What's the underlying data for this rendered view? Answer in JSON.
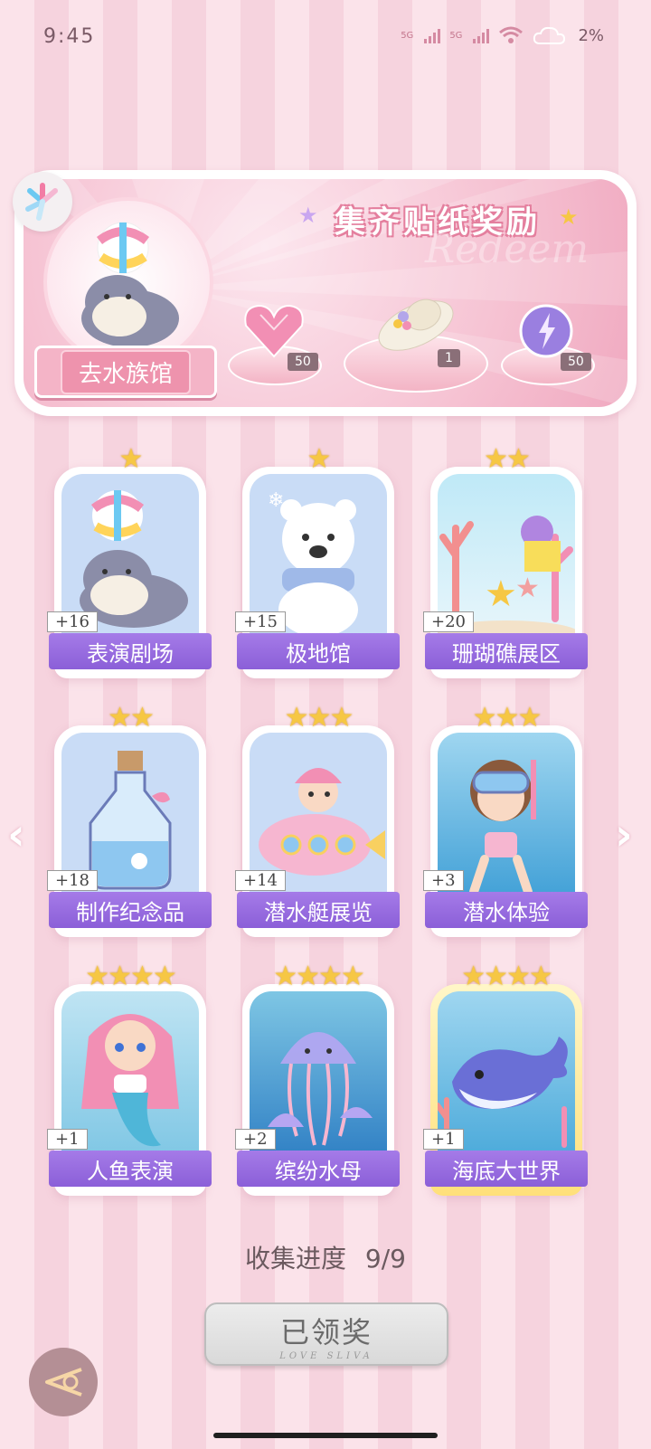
{
  "status": {
    "time": "9:45",
    "net1": "5G",
    "net2": "5G",
    "battery": "2%"
  },
  "banner": {
    "title": "集齐贴纸奖励",
    "subtitle": "Redeem",
    "aquarium_button": "去水族馆"
  },
  "rewards": [
    {
      "name": "heart-gem",
      "count": "50"
    },
    {
      "name": "hat",
      "count": "1"
    },
    {
      "name": "purple-orb",
      "count": "50"
    }
  ],
  "cards": [
    {
      "label": "表演剧场",
      "count": "+16",
      "stars": "★"
    },
    {
      "label": "极地馆",
      "count": "+15",
      "stars": "★"
    },
    {
      "label": "珊瑚礁展区",
      "count": "+20",
      "stars": "★★"
    },
    {
      "label": "制作纪念品",
      "count": "+18",
      "stars": "★★"
    },
    {
      "label": "潜水艇展览",
      "count": "+14",
      "stars": "★★★"
    },
    {
      "label": "潜水体验",
      "count": "+3",
      "stars": "★★★"
    },
    {
      "label": "人鱼表演",
      "count": "+1",
      "stars": "★★★★"
    },
    {
      "label": "缤纷水母",
      "count": "+2",
      "stars": "★★★★"
    },
    {
      "label": "海底大世界",
      "count": "+1",
      "stars": "★★★★"
    }
  ],
  "progress": {
    "label": "收集进度",
    "value": "9/9"
  },
  "claim": {
    "label": "已领奖",
    "sub": "LOVE SLIVA"
  },
  "nav": {
    "prev": "‹",
    "next": "›"
  }
}
